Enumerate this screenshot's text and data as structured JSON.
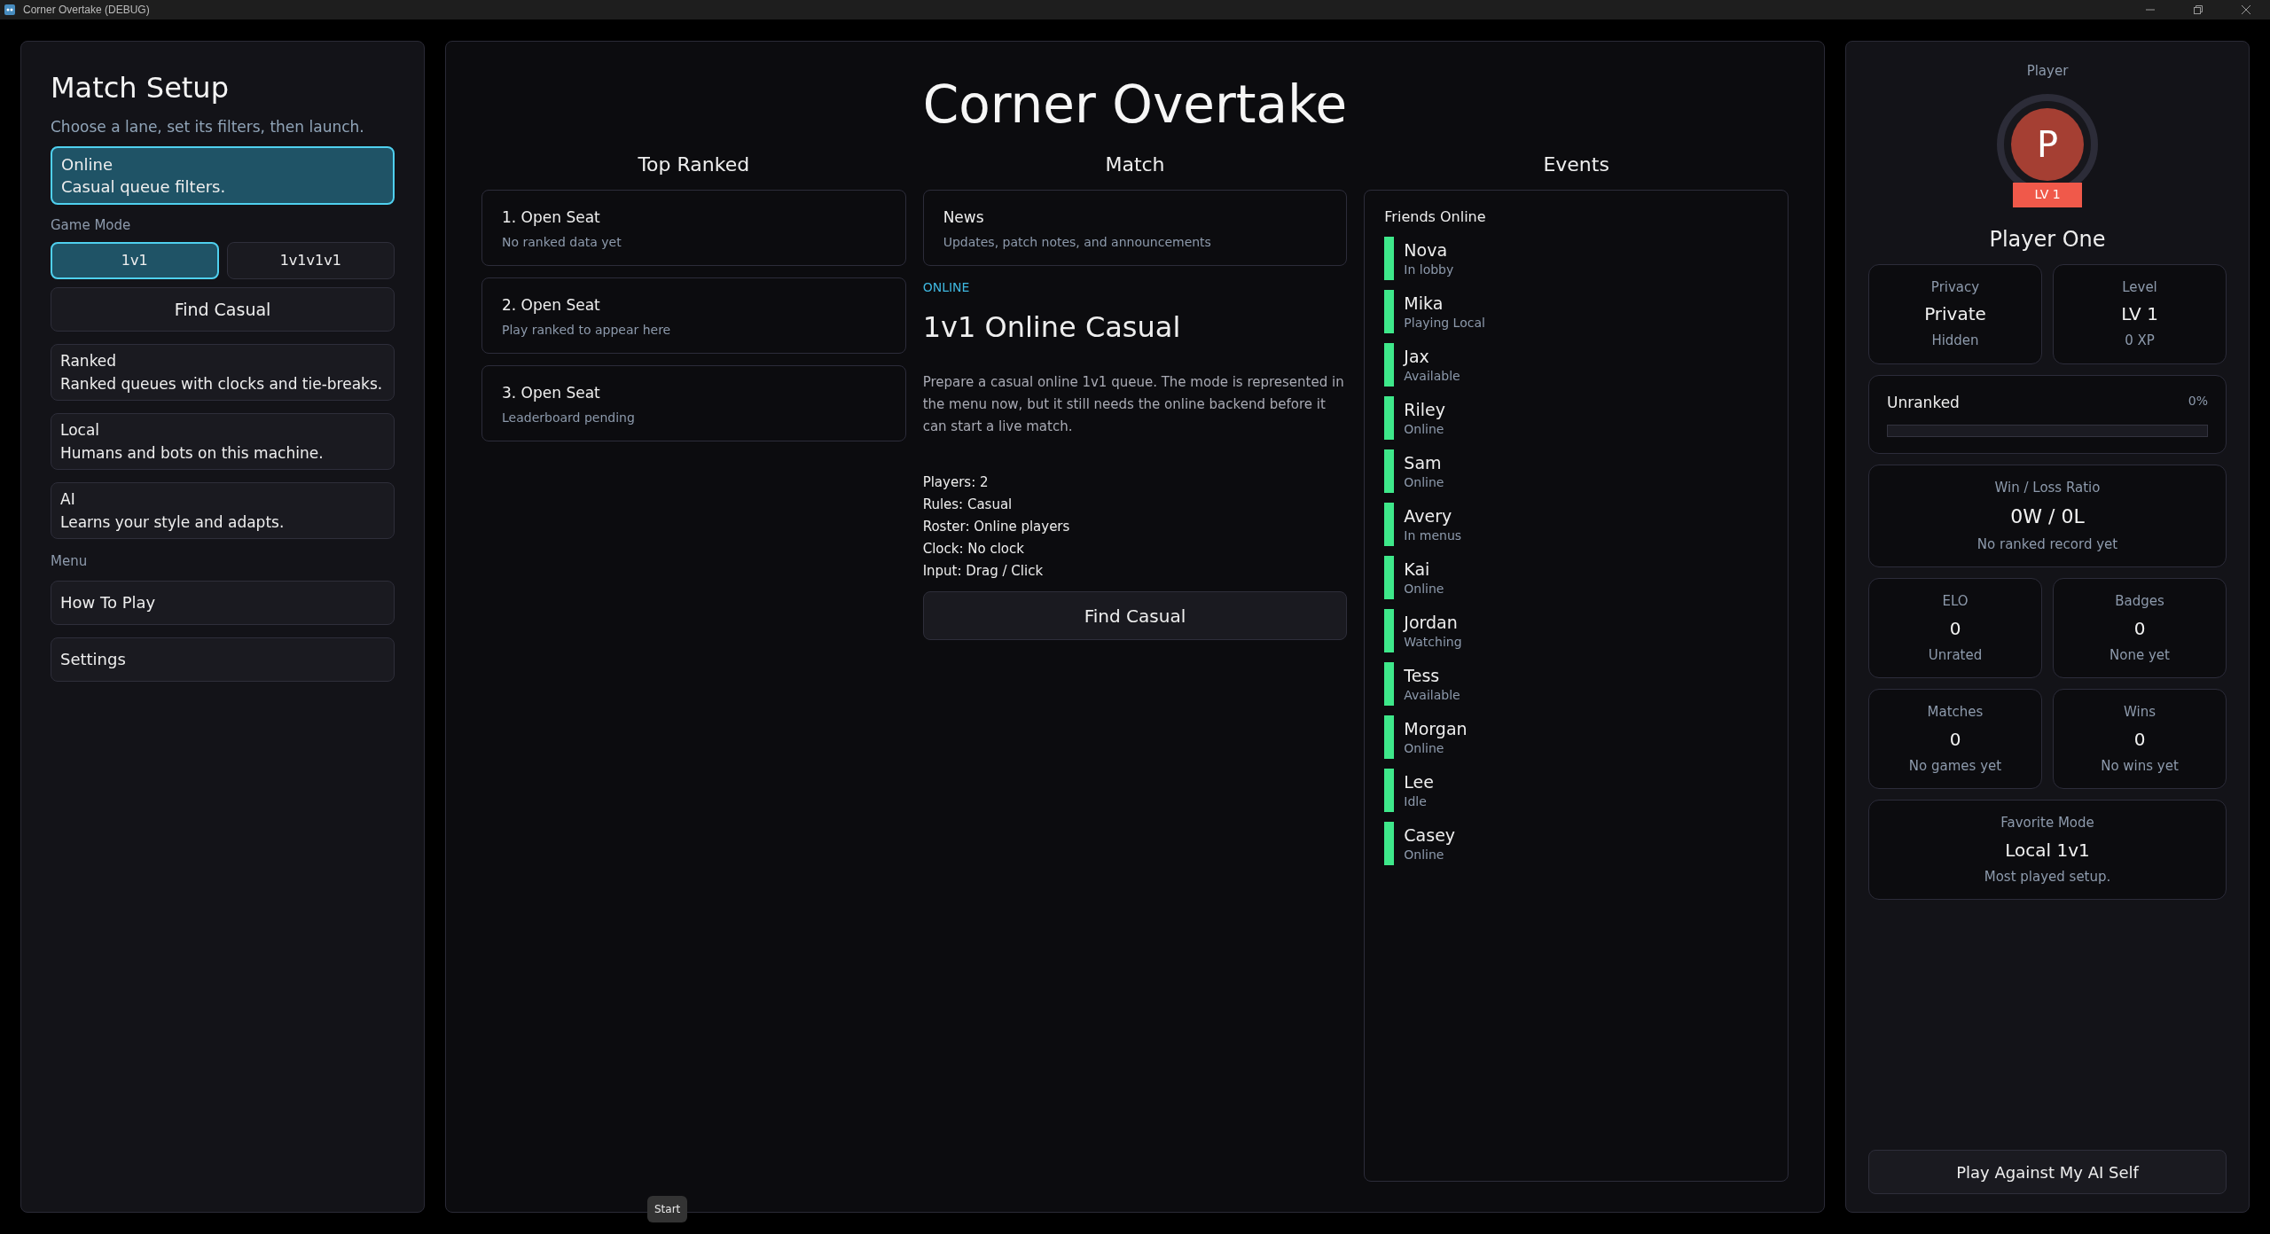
{
  "window": {
    "title": "Corner Overtake (DEBUG)"
  },
  "setup": {
    "title": "Match Setup",
    "subtitle": "Choose a lane, set its filters, then launch.",
    "lanes": [
      {
        "name": "Online",
        "description": "Casual queue filters.",
        "selected": true
      },
      {
        "name": "Ranked",
        "description": "Ranked queues with clocks and tie-breaks.",
        "selected": false
      },
      {
        "name": "Local",
        "description": "Humans and bots on this machine.",
        "selected": false
      },
      {
        "name": "AI",
        "description": "Learns your style and adapts.",
        "selected": false
      }
    ],
    "game_mode_label": "Game Mode",
    "modes": [
      {
        "label": "1v1",
        "selected": true
      },
      {
        "label": "1v1v1v1",
        "selected": false
      }
    ],
    "find_button": "Find Casual",
    "menu_label": "Menu",
    "menu_items": [
      "How To Play",
      "Settings"
    ]
  },
  "main": {
    "title": "Corner Overtake",
    "top_ranked": {
      "heading": "Top Ranked",
      "entries": [
        {
          "title": "1. Open Seat",
          "subtitle": "No ranked data yet"
        },
        {
          "title": "2. Open Seat",
          "subtitle": "Play ranked to appear here"
        },
        {
          "title": "3. Open Seat",
          "subtitle": "Leaderboard pending"
        }
      ]
    },
    "match": {
      "heading": "Match",
      "news": {
        "title": "News",
        "subtitle": "Updates, patch notes, and announcements"
      },
      "tag": "ONLINE",
      "mode_title": "1v1 Online Casual",
      "description": "Prepare a casual online 1v1 queue. The mode is represented in the menu now, but it still needs the online backend before it can start a live match.",
      "details": [
        "Players: 2",
        "Rules: Casual",
        "Roster: Online players",
        "Clock: No clock",
        "Input: Drag / Click"
      ],
      "button": "Find Casual"
    },
    "events": {
      "heading": "Events",
      "friends_title": "Friends Online",
      "friends": [
        {
          "name": "Nova",
          "status": "In lobby"
        },
        {
          "name": "Mika",
          "status": "Playing Local"
        },
        {
          "name": "Jax",
          "status": "Available"
        },
        {
          "name": "Riley",
          "status": "Online"
        },
        {
          "name": "Sam",
          "status": "Online"
        },
        {
          "name": "Avery",
          "status": "In menus"
        },
        {
          "name": "Kai",
          "status": "Online"
        },
        {
          "name": "Jordan",
          "status": "Watching"
        },
        {
          "name": "Tess",
          "status": "Available"
        },
        {
          "name": "Morgan",
          "status": "Online"
        },
        {
          "name": "Lee",
          "status": "Idle"
        },
        {
          "name": "Casey",
          "status": "Online"
        }
      ]
    }
  },
  "player": {
    "label": "Player",
    "initial": "P",
    "badge": "LV 1",
    "name": "Player One",
    "top_stats": [
      {
        "label": "Privacy",
        "value": "Private",
        "note": "Hidden"
      },
      {
        "label": "Level",
        "value": "LV 1",
        "note": "0 XP"
      }
    ],
    "rank": {
      "name": "Unranked",
      "percent": "0%",
      "level": 0
    },
    "ratio": {
      "label": "Win / Loss Ratio",
      "value": "0W / 0L",
      "note": "No ranked record yet"
    },
    "stats": [
      {
        "label": "ELO",
        "value": "0",
        "note": "Unrated"
      },
      {
        "label": "Badges",
        "value": "0",
        "note": "None yet"
      },
      {
        "label": "Matches",
        "value": "0",
        "note": "No games yet"
      },
      {
        "label": "Wins",
        "value": "0",
        "note": "No wins yet"
      }
    ],
    "favorite": {
      "label": "Favorite Mode",
      "value": "Local 1v1",
      "note": "Most played setup."
    },
    "button": "Play Against My AI Self"
  },
  "tooltip": "Start"
}
